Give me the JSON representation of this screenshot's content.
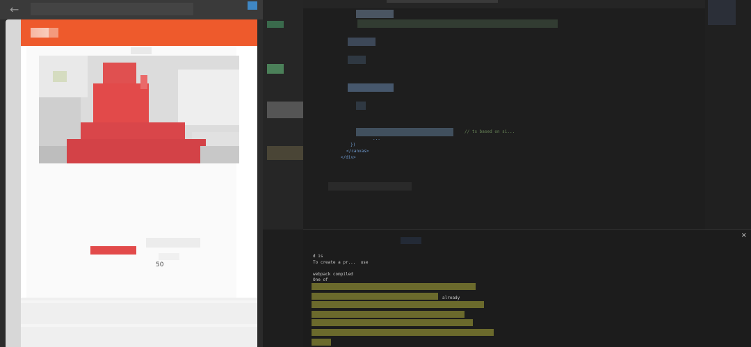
{
  "preview": {
    "back_icon": "←",
    "header_color": "#ee5a2c",
    "stat_value": "50"
  },
  "editor": {
    "line_closing_paren": "})",
    "line_close_canvas": "</canvas>",
    "line_close_div": "</div>",
    "line_tail": "...",
    "comment_text": "// ts based on si..."
  },
  "terminal": {
    "close_icon": "×",
    "line_1": "d is",
    "line_2": "To create a pr...  use",
    "webpack_line": "webpack compiled",
    "line_4": "One of",
    "line_5": "already"
  },
  "colors": {
    "accent": "#ee5a2c",
    "snippet_bar": "#e24a4a",
    "terminal_highlight": "#6b6a2c"
  }
}
